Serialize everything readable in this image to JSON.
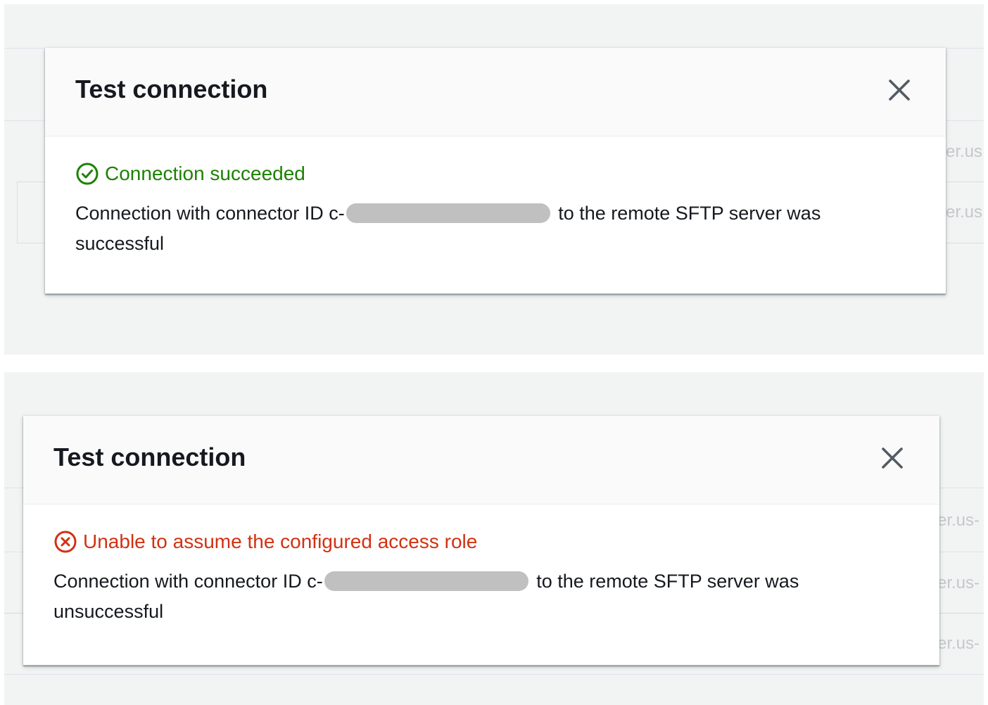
{
  "dialogs": [
    {
      "title": "Test connection",
      "status_text": "Connection succeeded",
      "status_color": "#1d8102",
      "status_icon": "check-circle-icon",
      "message_before": "Connection with connector ID c-",
      "message_after": "to the remote SFTP server was successful"
    },
    {
      "title": "Test connection",
      "status_text": "Unable to assume the configured access role",
      "status_color": "#d13212",
      "status_icon": "x-circle-icon",
      "message_before": "Connection with connector ID c-",
      "message_after": "to the remote SFTP server was unsuccessful"
    }
  ],
  "background": {
    "partial_text": [
      "er.us",
      "er.us",
      "er.us-",
      "er.us-",
      "er.us-"
    ]
  }
}
